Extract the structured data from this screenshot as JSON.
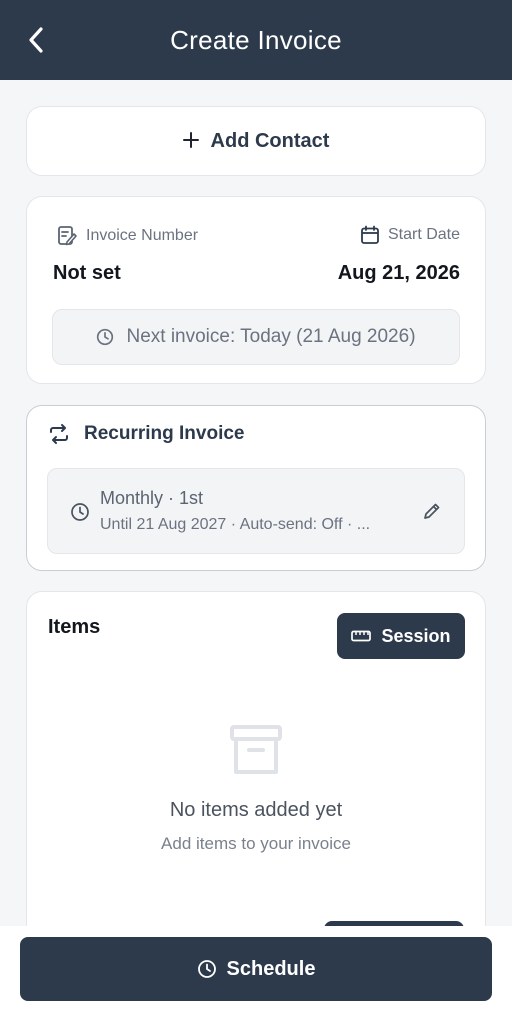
{
  "header": {
    "title": "Create Invoice",
    "back_icon": "chevron-left-icon",
    "background": "#2c3a4c"
  },
  "contact": {
    "add_label": "Add Contact",
    "icon": "plus-icon"
  },
  "invoice": {
    "number_label": "Invoice Number",
    "number_value": "Not set",
    "start_date_label": "Start Date",
    "start_date_value": "Aug 21, 2026",
    "next_invoice": "Next invoice: Today (21 Aug 2026)"
  },
  "recurring": {
    "title": "Recurring Invoice",
    "frequency": "Monthly · 1st",
    "details": "Until 21 Aug 2027 · Auto-send: Off · ..."
  },
  "items": {
    "title": "Items",
    "session_label": "Session",
    "empty_title": "No items added yet",
    "empty_subtitle": "Add items to your invoice"
  },
  "footer": {
    "schedule_label": "Schedule"
  },
  "colors": {
    "primary": "#2c3a4c",
    "background": "#f5f6f8",
    "muted_text": "#6b7280"
  }
}
